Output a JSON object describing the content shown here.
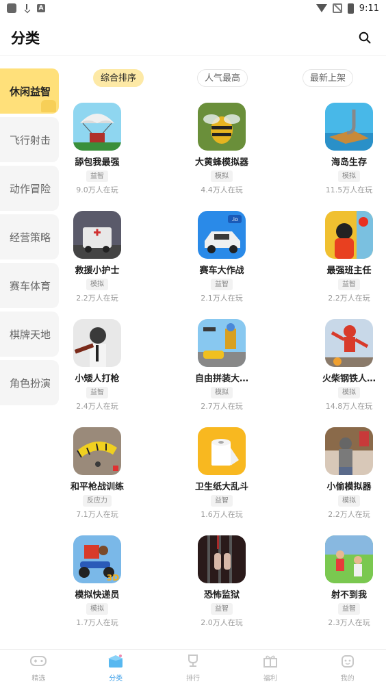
{
  "status_bar": {
    "time": "9:11",
    "a_label": "A"
  },
  "header": {
    "title": "分类"
  },
  "sidebar": {
    "items": [
      {
        "label": "休闲益智",
        "active": true
      },
      {
        "label": "飞行射击",
        "active": false
      },
      {
        "label": "动作冒险",
        "active": false
      },
      {
        "label": "经营策略",
        "active": false
      },
      {
        "label": "赛车体育",
        "active": false
      },
      {
        "label": "棋牌天地",
        "active": false
      },
      {
        "label": "角色扮演",
        "active": false
      }
    ]
  },
  "sort_tabs": [
    {
      "label": "综合排序",
      "active": true
    },
    {
      "label": "人气最高",
      "active": false
    },
    {
      "label": "最新上架",
      "active": false
    }
  ],
  "games": [
    {
      "name": "舔包我最强",
      "tag": "益智",
      "players": "9.0万人在玩",
      "icon": "parachute-crate-icon",
      "colors": [
        "#8fd6f0",
        "#3a8f3a"
      ]
    },
    {
      "name": "大黄蜂模拟器",
      "tag": "模拟",
      "players": "4.4万人在玩",
      "icon": "bee-icon",
      "colors": [
        "#6a8f3a",
        "#e6b420"
      ]
    },
    {
      "name": "海岛生存",
      "tag": "模拟",
      "players": "11.5万人在玩",
      "icon": "island-hook-icon",
      "colors": [
        "#48b8e8",
        "#c88a3a"
      ]
    },
    {
      "name": "救援小护士",
      "tag": "模拟",
      "players": "2.2万人在玩",
      "icon": "ambulance-icon",
      "colors": [
        "#5a5a6a",
        "#e8e8e8"
      ]
    },
    {
      "name": "赛车大作战",
      "tag": "益智",
      "players": "2.1万人在玩",
      "icon": "race-car-icon",
      "colors": [
        "#2a8ae8",
        "#f0f0f0"
      ]
    },
    {
      "name": "最强班主任",
      "tag": "益智",
      "players": "2.2万人在玩",
      "icon": "teacher-icon",
      "colors": [
        "#f0c030",
        "#e84020"
      ]
    },
    {
      "name": "小矮人打枪",
      "tag": "益智",
      "players": "2.4万人在玩",
      "icon": "soldier-icon",
      "colors": [
        "#e8e8e8",
        "#7a2a1a"
      ]
    },
    {
      "name": "自由拼装大…",
      "tag": "模拟",
      "players": "2.7万人在玩",
      "icon": "robot-car-icon",
      "colors": [
        "#88c8f0",
        "#f0c020"
      ]
    },
    {
      "name": "火柴钢铁人…",
      "tag": "模拟",
      "players": "14.8万人在玩",
      "icon": "hero-icon",
      "colors": [
        "#c8d8e8",
        "#d83a2a"
      ]
    },
    {
      "name": "和平枪战训练",
      "tag": "反应力",
      "players": "7.1万人在玩",
      "icon": "yellow-parachute-icon",
      "colors": [
        "#9a8a7a",
        "#f0d020"
      ]
    },
    {
      "name": "卫生纸大乱斗",
      "tag": "益智",
      "players": "1.6万人在玩",
      "icon": "toilet-paper-icon",
      "colors": [
        "#f8b820",
        "#ffffff"
      ]
    },
    {
      "name": "小偷模拟器",
      "tag": "模拟",
      "players": "2.2万人在玩",
      "icon": "thief-icon",
      "colors": [
        "#d8c8b8",
        "#5a6a8a"
      ]
    },
    {
      "name": "模拟快递员",
      "tag": "模拟",
      "players": "1.7万人在玩",
      "icon": "delivery-bike-icon",
      "colors": [
        "#7ab8e8",
        "#d83a2a"
      ]
    },
    {
      "name": "恐怖监狱",
      "tag": "益智",
      "players": "2.0万人在玩",
      "icon": "prison-hands-icon",
      "colors": [
        "#2a1a1a",
        "#a82a2a"
      ]
    },
    {
      "name": "射不到我",
      "tag": "益智",
      "players": "2.3万人在玩",
      "icon": "dodge-kids-icon",
      "colors": [
        "#7ac850",
        "#e8c8a8"
      ]
    }
  ],
  "bottom_nav": [
    {
      "label": "精选",
      "active": false,
      "icon": "gamepad-icon"
    },
    {
      "label": "分类",
      "active": true,
      "icon": "category-box-icon"
    },
    {
      "label": "排行",
      "active": false,
      "icon": "trophy-icon"
    },
    {
      "label": "福利",
      "active": false,
      "icon": "gift-icon"
    },
    {
      "label": "我的",
      "active": false,
      "icon": "profile-icon"
    }
  ]
}
